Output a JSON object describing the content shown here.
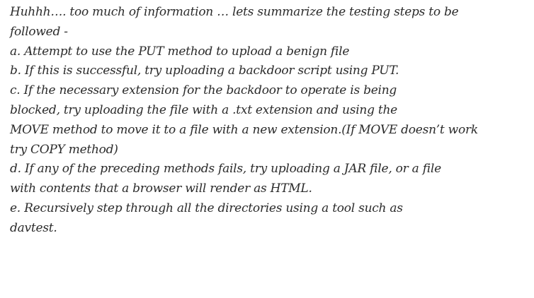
{
  "lines": [
    "Huhhh…. too much of information … lets summarize the testing steps to be",
    "followed -",
    "a. Attempt to use the PUT method to upload a benign file",
    "b. If this is successful, try uploading a backdoor script using PUT.",
    "c. If the necessary extension for the backdoor to operate is being",
    "blocked, try uploading the file with a .txt extension and using the",
    "MOVE method to move it to a file with a new extension.(If MOVE doesn’t work",
    "try COPY method)",
    "d. If any of the preceding methods fails, try uploading a JAR file, or a file",
    "with contents that a browser will render as HTML.",
    "e. Recursively step through all the directories using a tool such as",
    "davtest."
  ]
}
